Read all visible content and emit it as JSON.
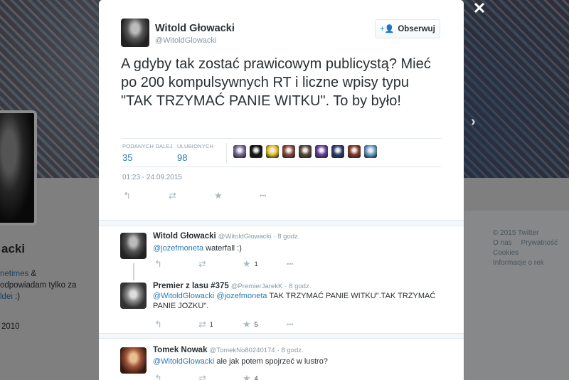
{
  "background": {
    "profile_name": "acki",
    "bio_line1_link": "netimes",
    "bio_line1_suffix": " &",
    "bio_line2": " odpowiadam tylko za",
    "bio_line3_link": "ldei",
    "bio_line3_suffix": " :)",
    "joined_year": "2010",
    "footer": [
      "© 2015 Twitter",
      "O nas",
      "Prywatność",
      "Cookies",
      "Informacje o rek"
    ]
  },
  "close_icon": "✕",
  "next_arrow_icon": "›",
  "main_tweet": {
    "author_name": "Witold Głowacki",
    "author_handle": "@WitoldGlowacki",
    "follow_label": "Obserwuj",
    "text": "A gdyby tak zostać prawicowym publicystą? Mieć po 200 kompulsywnych RT i liczne wpisy typu \"TAK TRZYMAĆ PANIE WITKU\". To by było!",
    "retweets_label": "PODANYCH DALEJ",
    "retweets_value": "35",
    "favorites_label": "ULUBIONYCH",
    "favorites_value": "98",
    "fav_avatar_colors": [
      "#7a6aa0",
      "#111111",
      "#e6c12a",
      "#8b4a3a",
      "#5a4a3a",
      "#6a3fa0",
      "#2b3d6a",
      "#8a3a2a",
      "#6aa0c8"
    ],
    "timestamp": "01:23 - 24.09.2015",
    "actions": [
      "reply-icon",
      "retweet-icon",
      "favorite-icon",
      "more-icon"
    ]
  },
  "replies": [
    {
      "name": "Witold Głowacki",
      "handle": "@WitoldGlowacki",
      "time": "8 godz.",
      "mention": "@jozefmoneta",
      "text": " waterfall :)",
      "retweets": "",
      "favorites": "1",
      "avatar_color": "#555555"
    },
    {
      "name": "Premier z lasu #375",
      "handle": "@PremierJarekK",
      "time": "8 godz.",
      "mention": "@WitoldGlowacki @jozefmoneta",
      "text": " TAK TRZYMAĆ PANIE WITKU\".TAK TRZYMAĆ PANIE JOZKU\".",
      "retweets": "1",
      "favorites": "5",
      "avatar_color": "#6b6b6b"
    },
    {
      "name": "Tomek Nowak",
      "handle": "@TomekNo80240174",
      "time": "8 godz.",
      "mention": "@WitoldGlowacki",
      "text": " ale jak potem spojrzeć w lustro?",
      "retweets": "",
      "favorites": "4",
      "avatar_color": "#a0553a"
    }
  ],
  "icons": {
    "reply": "↰",
    "retweet": "⇄",
    "favorite": "★",
    "more": "•••",
    "follow": "+👤"
  }
}
